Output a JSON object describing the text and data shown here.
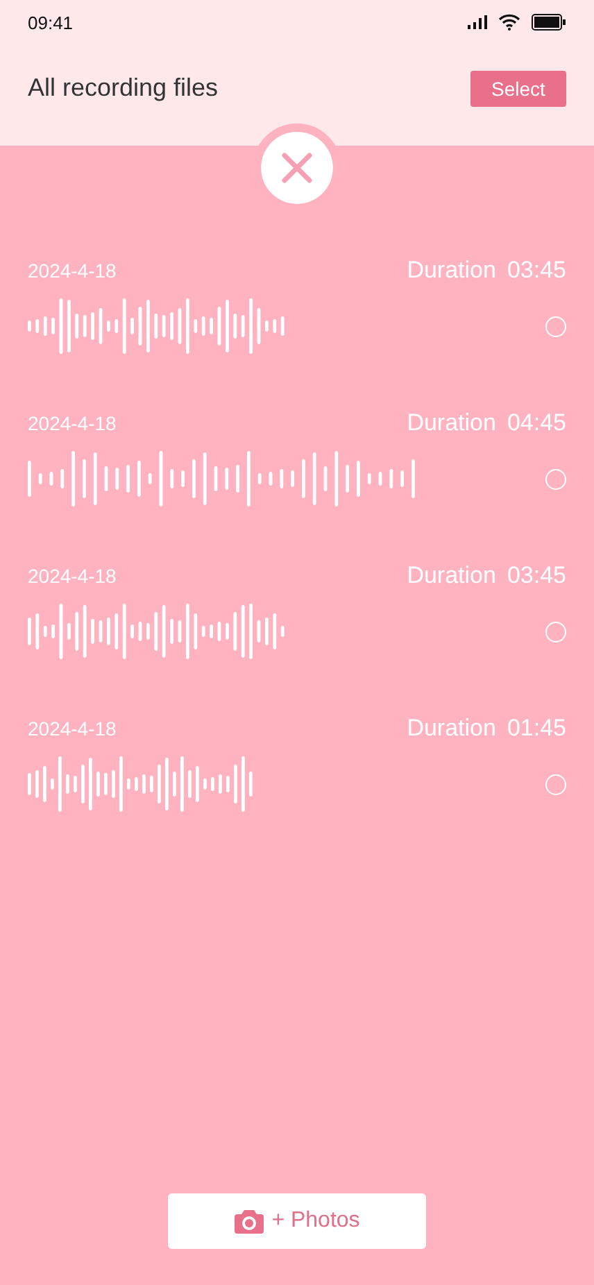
{
  "status_bar": {
    "time": "09:41"
  },
  "header": {
    "title": "All recording files",
    "select_button": "Select"
  },
  "recordings": [
    {
      "date": "2024-4-18",
      "duration_label": "Duration",
      "duration": "03:45",
      "selected": false
    },
    {
      "date": "2024-4-18",
      "duration_label": "Duration",
      "duration": "04:45",
      "selected": false
    },
    {
      "date": "2024-4-18",
      "duration_label": "Duration",
      "duration": "03:45",
      "selected": false
    },
    {
      "date": "2024-4-18",
      "duration_label": "Duration",
      "duration": "01:45",
      "selected": false
    }
  ],
  "photos_button": {
    "label": "+ Photos"
  }
}
